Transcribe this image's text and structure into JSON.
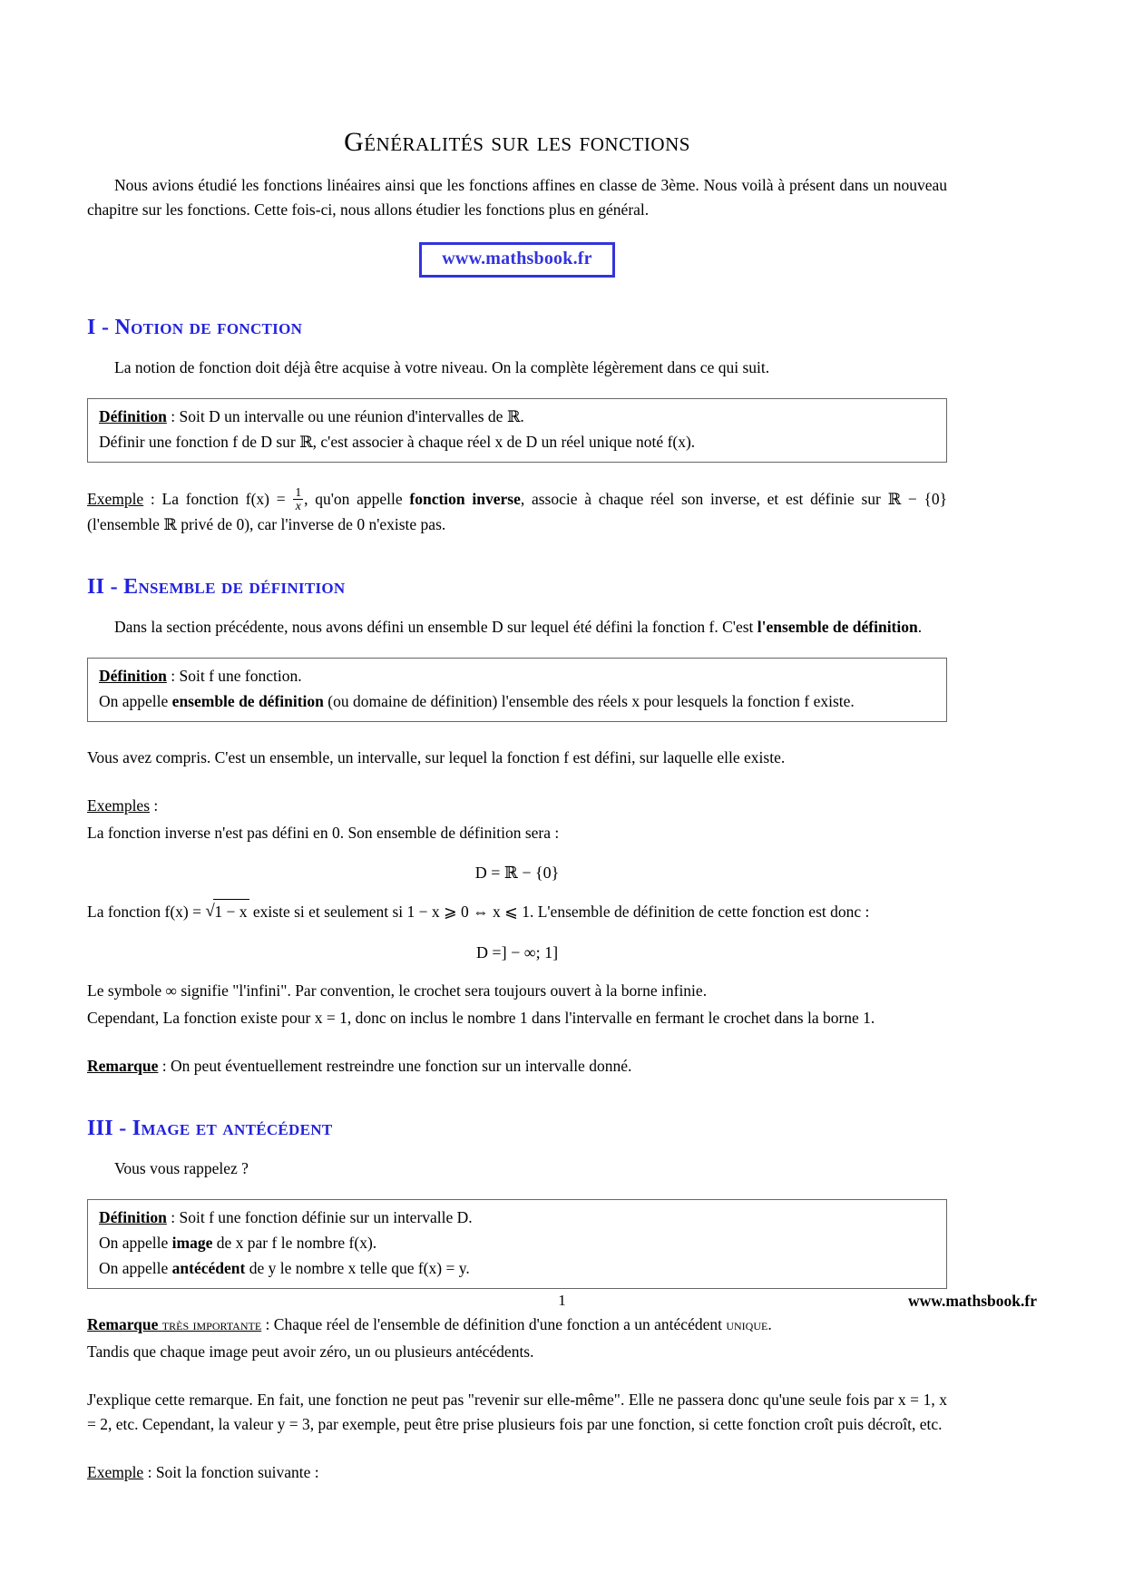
{
  "document": {
    "title": "Généralités sur les fonctions",
    "intro": "Nous avions étudié les fonctions linéaires ainsi que les fonctions affines en classe de 3ème. Nous voilà à présent dans un nouveau chapitre sur les fonctions. Cette fois-ci, nous allons étudier les fonctions plus en général.",
    "brand_box": "www.mathsbook.fr"
  },
  "section1": {
    "heading": "I - Notion de fonction",
    "intro": "La notion de fonction doit déjà être acquise à votre niveau. On la complète légèrement dans ce qui suit.",
    "definition": {
      "label": "Définition",
      "line1_after_label": " : Soit D un intervalle ou une réunion d'intervalles de ℝ.",
      "line2": "Définir une fonction f de D sur ℝ, c'est associer à chaque réel x de D un réel unique noté f(x)."
    },
    "example": {
      "label": "Exemple",
      "part1": " : La fonction f(x) = ",
      "fraction_num": "1",
      "fraction_den": "x",
      "part2": ", qu'on appelle ",
      "bold_term": "fonction inverse",
      "part3": ", associe à chaque réel son inverse, et est définie sur ℝ − {0} (l'ensemble ℝ privé de 0), car l'inverse de 0 n'existe pas."
    }
  },
  "section2": {
    "heading": "II - Ensemble de définition",
    "intro_a": "Dans la section précédente, nous avons défini un ensemble D sur lequel été défini la fonction f. C'est ",
    "intro_bold": "l'ensemble de définition",
    "intro_b": ".",
    "definition": {
      "label": "Définition",
      "line1_after_label": " : Soit f une fonction.",
      "line2_a": "On appelle ",
      "line2_bold": "ensemble de définition",
      "line2_b": " (ou domaine de définition) l'ensemble des réels x pour lesquels la fonction f existe."
    },
    "para_compris": "Vous avez compris. C'est un ensemble, un intervalle, sur lequel la fonction f est défini, sur laquelle elle existe.",
    "examples_label": "Exemples",
    "examples_colon": " :",
    "example_line1": "La fonction inverse n'est pas défini en 0. Son ensemble de définition sera :",
    "equation1": "D = ℝ − {0}",
    "example_line2_a": "La fonction f(x) = ",
    "example_line2_sqrt": "1 − x",
    "example_line2_b": " existe si et seulement si 1 − x ⩾ 0 ⇔ x ⩽ 1. L'ensemble de définition de cette fonction est donc :",
    "equation2": "D =] − ∞; 1]",
    "note_line1": "Le symbole ∞ signifie \"l'infini\". Par convention, le crochet sera toujours ouvert à la borne infinie.",
    "note_line2": "Cependant, La fonction existe pour x = 1, donc on inclus le nombre 1 dans l'intervalle en fermant le crochet dans la borne 1.",
    "remark_label": "Remarque",
    "remark_text": " : On peut éventuellement restreindre une fonction sur un intervalle donné."
  },
  "section3": {
    "heading": "III - Image et antécédent",
    "intro": "Vous vous rappelez ?",
    "definition": {
      "label": "Définition",
      "line1_after_label": " : Soit f une fonction définie sur un intervalle D.",
      "line2_a": "On appelle ",
      "line2_bold": "image",
      "line2_b": " de x par f le nombre f(x).",
      "line3_a": "On appelle ",
      "line3_bold": "antécédent",
      "line3_b": " de y le nombre x telle que f(x) = y."
    },
    "remark_label": "Remarque",
    "remark_smallcaps": "très importante",
    "remark_text_a": " : Chaque réel de l'ensemble de définition d'une fonction a un antécédent ",
    "remark_unique": "unique",
    "remark_text_b": ".",
    "remark_line2": "Tandis que chaque image peut avoir zéro, un ou plusieurs antécédents.",
    "explain_para": "J'explique cette remarque. En fait, une fonction ne peut pas \"revenir sur elle-même\". Elle ne passera donc qu'une seule fois par x = 1, x = 2, etc. Cependant, la valeur y = 3, par exemple, peut être prise plusieurs fois par une fonction, si cette fonction croît puis décroît, etc.",
    "example_label": "Exemple",
    "example_text": " : Soit la fonction suivante :"
  },
  "footer": {
    "page_number": "1",
    "site": "www.mathsbook.fr"
  },
  "colors": {
    "heading_blue": "#2222dd",
    "brand_blue": "#3333dd",
    "box_border": "#666666",
    "text": "#000000"
  }
}
